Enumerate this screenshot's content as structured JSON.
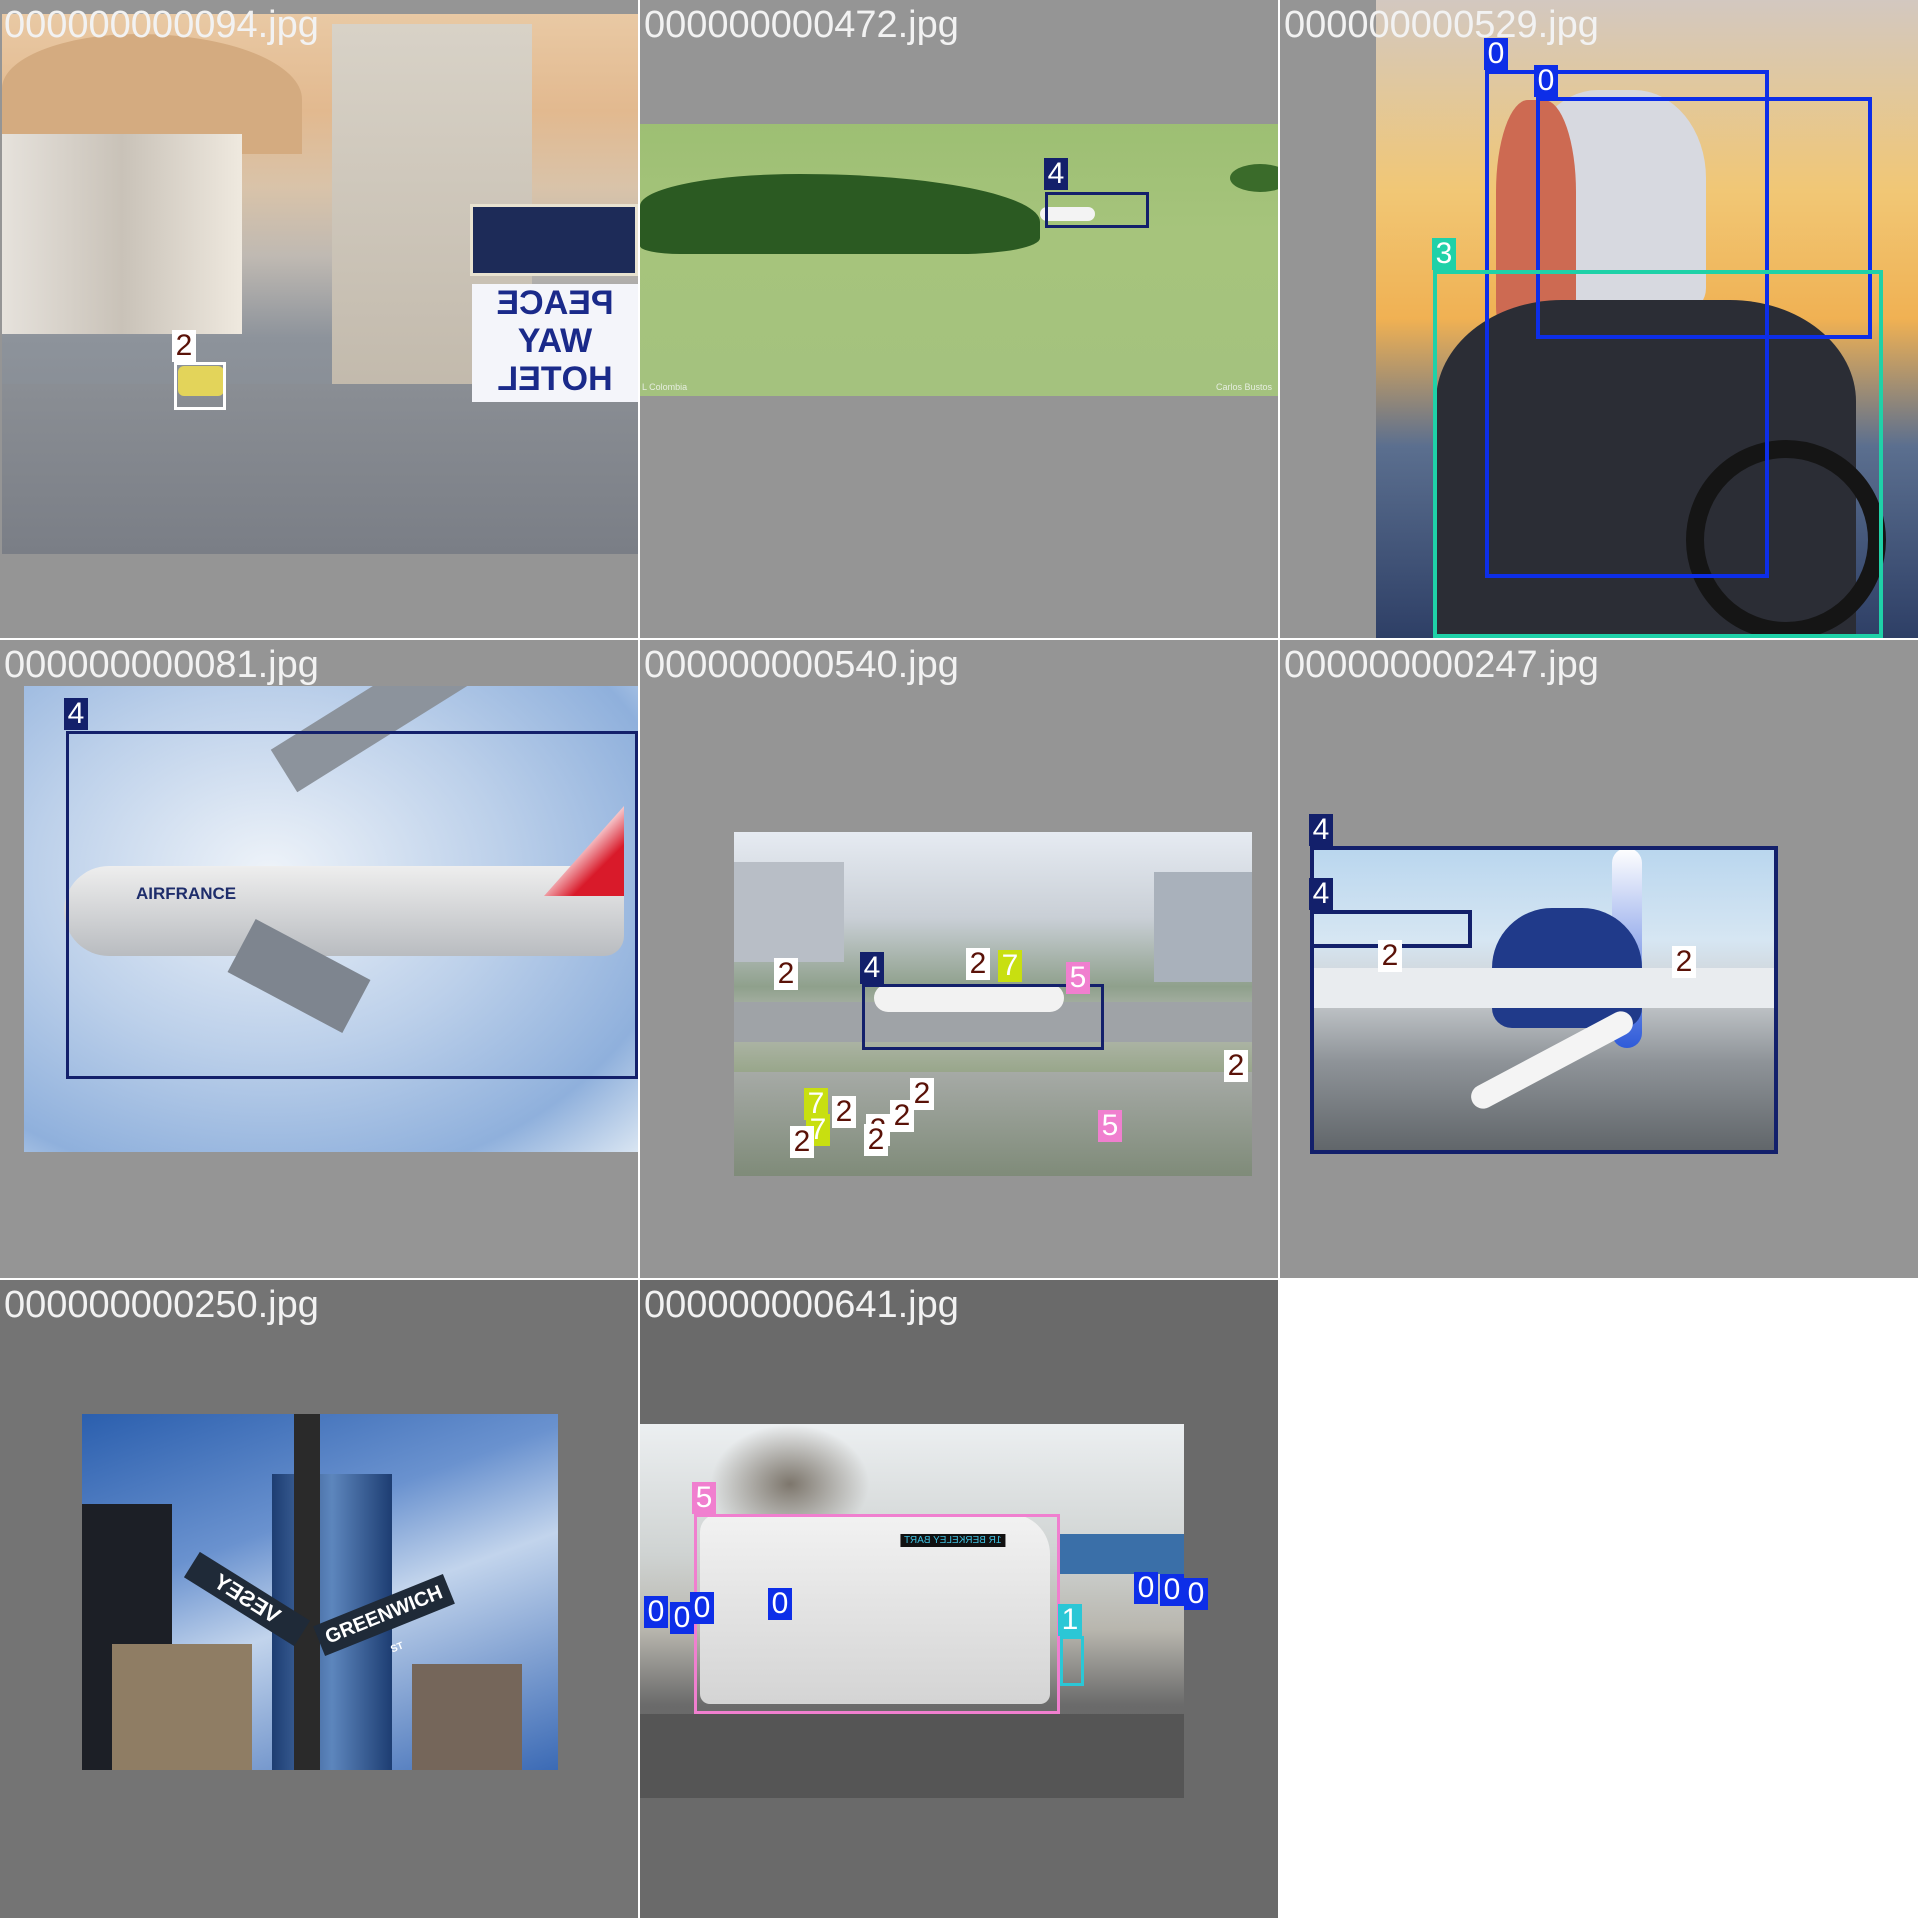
{
  "grid": {
    "cells": [
      {
        "filename": "000000000094.jpg",
        "labels": [
          "2"
        ]
      },
      {
        "filename": "000000000472.jpg",
        "labels": [
          "4"
        ],
        "watermark_left": "L Colombia",
        "watermark_right": "Carlos Bustos"
      },
      {
        "filename": "000000000529.jpg",
        "labels": [
          "0",
          "0",
          "3"
        ]
      },
      {
        "filename": "000000000081.jpg",
        "labels": [
          "4"
        ],
        "fuselage_text": "AIRFRANCE"
      },
      {
        "filename": "000000000540.jpg",
        "labels": [
          "4",
          "2",
          "2",
          "7",
          "5",
          "2",
          "2",
          "2",
          "2",
          "2",
          "7",
          "7",
          "2",
          "2",
          "5"
        ]
      },
      {
        "filename": "000000000247.jpg",
        "labels": [
          "4",
          "4",
          "2",
          "2"
        ]
      },
      {
        "filename": "000000000250.jpg",
        "labels": [],
        "sign_left": "VESEY",
        "sign_right": "GREENWICH",
        "sign_st": "ST"
      },
      {
        "filename": "000000000641.jpg",
        "labels": [
          "5",
          "0",
          "0",
          "0",
          "0",
          "0",
          "0",
          "0",
          "1"
        ],
        "bus_destination": "1R BERKELEY BART"
      }
    ],
    "hotel_sign": [
      "PEACE",
      "WAY",
      "HOTEL"
    ]
  },
  "colors": {
    "class_0": "#0d2ee8",
    "class_1": "#2bc7d6",
    "class_2": "#ffffff",
    "class_3": "#1fd1a8",
    "class_4": "#13206b",
    "class_5": "#f07fcf",
    "class_7": "#c8df10",
    "label_text_light": "#ffffff",
    "label_text_dark": "#5a1208"
  }
}
